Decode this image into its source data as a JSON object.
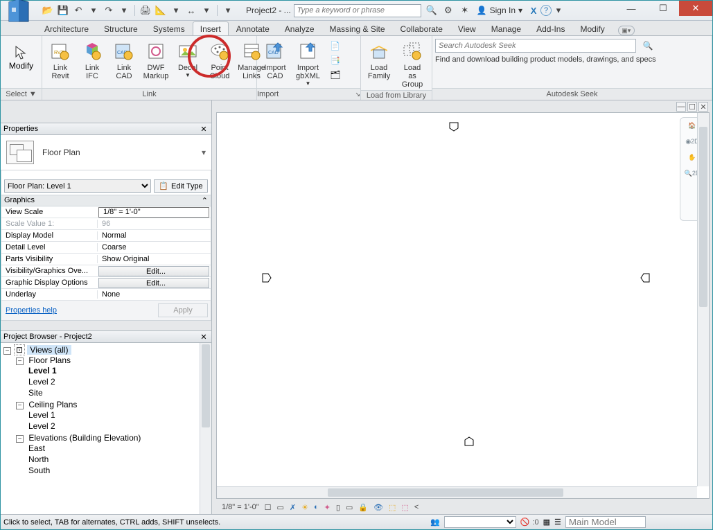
{
  "title": "Project2 - ...",
  "search_placeholder": "Type a keyword or phrase",
  "signin": "Sign In",
  "tabs": [
    "Architecture",
    "Structure",
    "Systems",
    "Insert",
    "Annotate",
    "Analyze",
    "Massing & Site",
    "Collaborate",
    "View",
    "Manage",
    "Add-Ins",
    "Modify"
  ],
  "active_tab": "Insert",
  "ribbon": {
    "select": {
      "modify": "Modify",
      "label": "Select ▼"
    },
    "link": {
      "label": "Link",
      "items": [
        "Link\nRevit",
        "Link\nIFC",
        "Link\nCAD",
        "DWF\nMarkup",
        "Decal",
        "Point\nCloud",
        "Manage\nLinks"
      ]
    },
    "import": {
      "label": "Import",
      "items": [
        "Import\nCAD",
        "Import\ngbXML"
      ]
    },
    "load_lib": {
      "label": "Load from Library",
      "items": [
        "Load\nFamily",
        "Load as\nGroup"
      ]
    },
    "seek": {
      "label": "Autodesk Seek",
      "placeholder": "Search Autodesk Seek",
      "desc": "Find and download building product models, drawings, and specs"
    }
  },
  "properties": {
    "title": "Properties",
    "family": "Floor Plan",
    "instance": "Floor Plan: Level 1",
    "edit_type": "Edit Type",
    "group": "Graphics",
    "rows": [
      {
        "k": "View Scale",
        "v": "1/8\" = 1'-0\"",
        "box": true
      },
      {
        "k": "Scale Value    1:",
        "v": "96",
        "disabled": true
      },
      {
        "k": "Display Model",
        "v": "Normal"
      },
      {
        "k": "Detail Level",
        "v": "Coarse"
      },
      {
        "k": "Parts Visibility",
        "v": "Show Original"
      },
      {
        "k": "Visibility/Graphics Ove...",
        "v": "Edit...",
        "btn": true
      },
      {
        "k": "Graphic Display Options",
        "v": "Edit...",
        "btn": true
      },
      {
        "k": "Underlay",
        "v": "None"
      }
    ],
    "help": "Properties help",
    "apply": "Apply"
  },
  "browser": {
    "title": "Project Browser - Project2",
    "root": "Views (all)",
    "tree": [
      {
        "label": "Floor Plans",
        "children": [
          {
            "label": "Level 1",
            "bold": true
          },
          {
            "label": "Level 2"
          },
          {
            "label": "Site"
          }
        ]
      },
      {
        "label": "Ceiling Plans",
        "children": [
          {
            "label": "Level 1"
          },
          {
            "label": "Level 2"
          }
        ]
      },
      {
        "label": "Elevations (Building Elevation)",
        "children": [
          {
            "label": "East"
          },
          {
            "label": "North"
          },
          {
            "label": "South"
          }
        ]
      }
    ]
  },
  "view_scale_status": "1/8\" = 1'-0\"",
  "status_msg": "Click to select, TAB for alternates, CTRL adds, SHIFT unselects.",
  "status_zero": ":0",
  "main_model": "Main Model"
}
